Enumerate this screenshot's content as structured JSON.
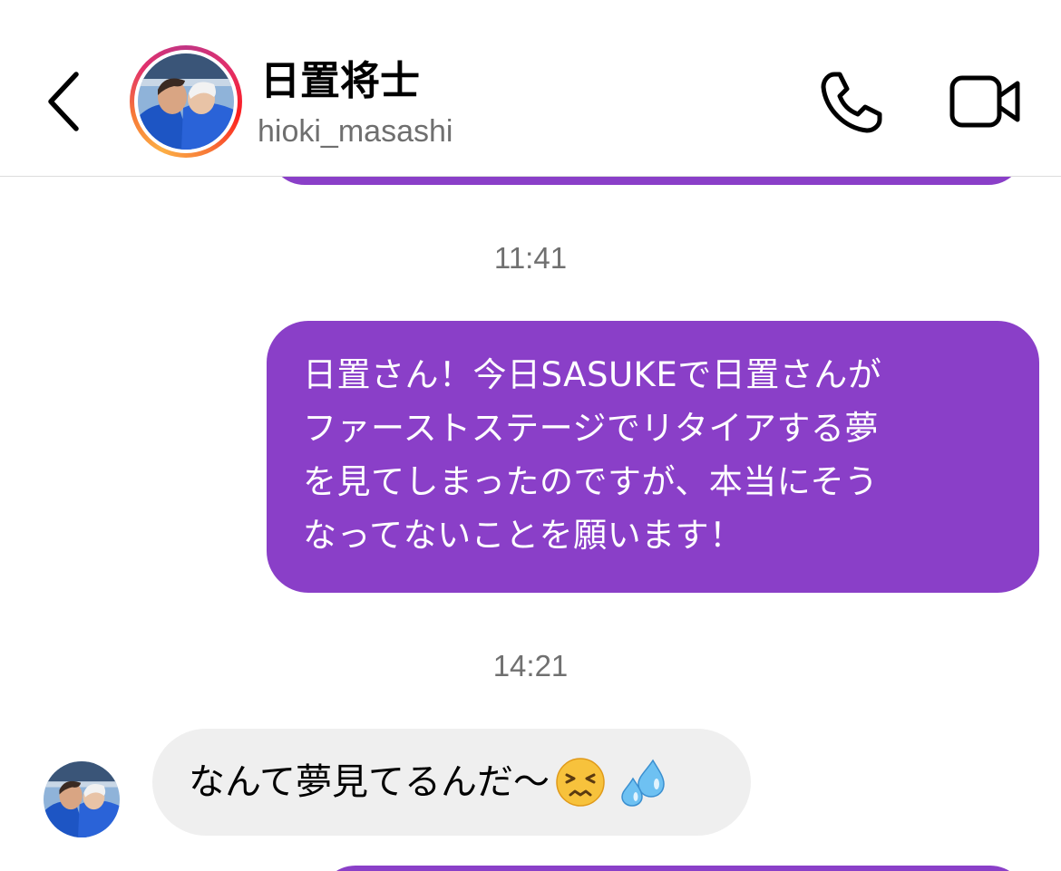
{
  "header": {
    "contact_name": "日置将士",
    "username": "hioki_masashi",
    "icons": {
      "back": "chevron-left-icon",
      "call": "phone-icon",
      "video": "video-camera-icon"
    }
  },
  "conversation": {
    "messages": [
      {
        "kind": "timestamp",
        "text": "11:41"
      },
      {
        "kind": "outgoing",
        "text": "日置さん！今日SASUKEで日置さんが\nファーストステージでリタイアする夢\nを見てしまったのですが、本当にそう\nなってないことを願います！"
      },
      {
        "kind": "timestamp",
        "text": "14:21"
      },
      {
        "kind": "incoming",
        "text": "なんて夢見てるんだ〜",
        "emojis": [
          "persevering-face-emoji",
          "sweat-droplets-emoji"
        ]
      }
    ]
  },
  "colors": {
    "outgoing_bubble": "#8a3fc8",
    "incoming_bubble": "#efefef",
    "timestamp_text": "#707070",
    "username_text": "#6f6f6f",
    "story_ring": [
      "#c13584",
      "#e1306c",
      "#f77737",
      "#fcaf45"
    ]
  }
}
